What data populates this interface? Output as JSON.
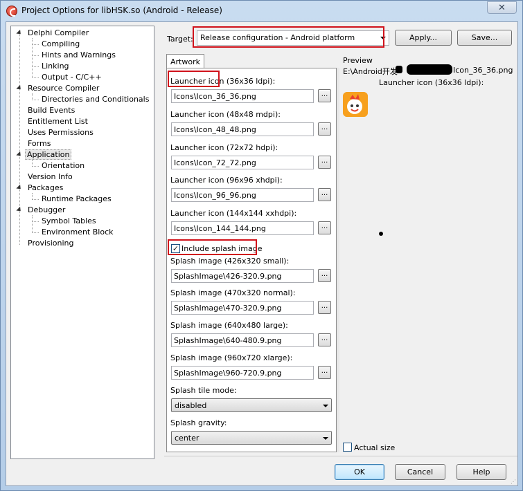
{
  "window": {
    "title": "Project Options for libHSK.so  (Android - Release)",
    "close_glyph": "✕"
  },
  "tree": {
    "items": [
      {
        "label": "Delphi Compiler",
        "level": 0,
        "expanded": true
      },
      {
        "label": "Compiling",
        "level": 1
      },
      {
        "label": "Hints and Warnings",
        "level": 1
      },
      {
        "label": "Linking",
        "level": 1
      },
      {
        "label": "Output - C/C++",
        "level": 1
      },
      {
        "label": "Resource Compiler",
        "level": 0,
        "expanded": true
      },
      {
        "label": "Directories and Conditionals",
        "level": 1
      },
      {
        "label": "Build Events",
        "level": 0
      },
      {
        "label": "Entitlement List",
        "level": 0
      },
      {
        "label": "Uses Permissions",
        "level": 0
      },
      {
        "label": "Forms",
        "level": 0
      },
      {
        "label": "Application",
        "level": 0,
        "expanded": true,
        "selected": true
      },
      {
        "label": "Orientation",
        "level": 1
      },
      {
        "label": "Version Info",
        "level": 0
      },
      {
        "label": "Packages",
        "level": 0,
        "expanded": true
      },
      {
        "label": "Runtime Packages",
        "level": 1
      },
      {
        "label": "Debugger",
        "level": 0,
        "expanded": true
      },
      {
        "label": "Symbol Tables",
        "level": 1
      },
      {
        "label": "Environment Block",
        "level": 1
      },
      {
        "label": "Provisioning",
        "level": 0
      }
    ]
  },
  "target": {
    "label": "Target:",
    "value": "Release configuration - Android platform",
    "apply_label": "Apply...",
    "save_label": "Save..."
  },
  "tab": {
    "label": "Artwork"
  },
  "fields": {
    "launcher36_label": "Launcher icon (36x36 ldpi):",
    "launcher36_value": "Icons\\Icon_36_36.png",
    "launcher48_label": "Launcher icon (48x48 mdpi):",
    "launcher48_value": "Icons\\Icon_48_48.png",
    "launcher72_label": "Launcher icon (72x72 hdpi):",
    "launcher72_value": "Icons\\Icon_72_72.png",
    "launcher96_label": "Launcher icon (96x96 xhdpi):",
    "launcher96_value": "Icons\\Icon_96_96.png",
    "launcher144_label": "Launcher icon (144x144 xxhdpi):",
    "launcher144_value": "Icons\\Icon_144_144.png",
    "include_splash_label": "Include splash image",
    "include_splash_checked": "✓",
    "splash_small_label": "Splash image (426x320 small):",
    "splash_small_value": "SplashImage\\426-320.9.png",
    "splash_normal_label": "Splash image (470x320 normal):",
    "splash_normal_value": "SplashImage\\470-320.9.png",
    "splash_large_label": "Splash image (640x480 large):",
    "splash_large_value": "SplashImage\\640-480.9.png",
    "splash_xlarge_label": "Splash image (960x720 xlarge):",
    "splash_xlarge_value": "SplashImage\\960-720.9.png",
    "tile_mode_label": "Splash tile mode:",
    "tile_mode_value": "disabled",
    "gravity_label": "Splash gravity:",
    "gravity_value": "center",
    "browse_label": "..."
  },
  "preview": {
    "label": "Preview",
    "path_start": "E:\\Android开发",
    "path_end": "Icon_36_36.png",
    "caption": "Launcher icon (36x36 ldpi):",
    "actual_size_label": "Actual size"
  },
  "buttons": {
    "ok": "OK",
    "cancel": "Cancel",
    "help": "Help"
  },
  "colors": {
    "highlight_box": "#d0121b",
    "ok_focus": "#3c7fb1"
  }
}
